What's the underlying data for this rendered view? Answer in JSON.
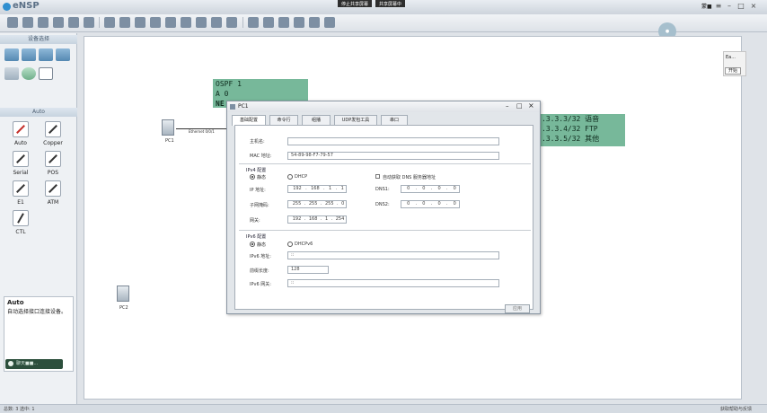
{
  "app": {
    "title": "eNSP",
    "top_buttons": [
      "停止共享屏幕",
      "共享屏幕中"
    ],
    "user_label": "蒙■"
  },
  "left_panel": {
    "devices_header": "设备选择",
    "cables_header": "Auto",
    "cables": [
      "Auto",
      "Copper",
      "Serial",
      "POS",
      "E1",
      "ATM",
      "CTL"
    ],
    "info_title": "Auto",
    "info_desc": "自动选择接口连接设备。",
    "chat_label": "聊天■■..."
  },
  "canvas": {
    "note1": [
      "OSPF 1",
      "A 0",
      "NE"
    ],
    "note2": [
      ".3.3.3/32 语音",
      ".3.3.4/32 FTP",
      ".3.3.5/32 其他"
    ],
    "pc1_label": "PC1",
    "pc1_port": "Ethernet 0/0/1",
    "pc2_label": "PC2",
    "mini_label": "Ea...",
    "mini_button": "开始"
  },
  "dialog": {
    "title": "PC1",
    "tabs": [
      "基础配置",
      "命令行",
      "组播",
      "UDP发包工具",
      "串口"
    ],
    "hostname_label": "主机名:",
    "hostname_value": "",
    "mac_label": "MAC 地址:",
    "mac_value": "54-89-98-F7-79-57",
    "ipv4_title": "IPv4 配置",
    "static_label": "静态",
    "dhcp_label": "DHCP",
    "auto_dns_label": "自动获取 DNS 服务器地址",
    "ip_label": "IP 地址:",
    "ip_value": [
      "192",
      "168",
      "1",
      "1"
    ],
    "mask_label": "子网掩码:",
    "mask_value": [
      "255",
      "255",
      "255",
      "0"
    ],
    "gw_label": "网关:",
    "gw_value": [
      "192",
      "168",
      "1",
      "254"
    ],
    "dns1_label": "DNS1:",
    "dns1_value": [
      "0",
      "0",
      "0",
      "0"
    ],
    "dns2_label": "DNS2:",
    "dns2_value": [
      "0",
      "0",
      "0",
      "0"
    ],
    "ipv6_title": "IPv6 配置",
    "static6_label": "静态",
    "dhcpv6_label": "DHCPv6",
    "ipv6_label": "IPv6 地址:",
    "ipv6_value": "::",
    "prefix_label": "前缀长度:",
    "prefix_value": "128",
    "gw6_label": "IPv6 网关:",
    "gw6_value": "::",
    "apply_label": "应用"
  },
  "status": {
    "left": "总数: 3 选中: 1",
    "right": "获取帮助与反馈"
  },
  "colors": {
    "note_bg": "#77b89a",
    "titlebar": "#cdd4dc"
  }
}
